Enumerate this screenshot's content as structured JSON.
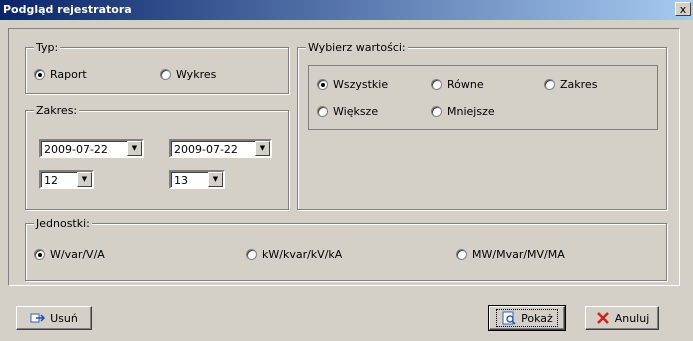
{
  "window": {
    "title": "Podgląd rejestratora",
    "close": "x"
  },
  "typ": {
    "legend": "Typ:",
    "options": [
      {
        "label": "Raport",
        "selected": true
      },
      {
        "label": "Wykres",
        "selected": false
      }
    ]
  },
  "zakres": {
    "legend": "Zakres:",
    "date_from": "2009-07-22",
    "date_to": "2009-07-22",
    "hour_from": "12",
    "hour_to": "13"
  },
  "wybierz": {
    "legend": "Wybierz wartości:",
    "options": [
      {
        "label": "Wszystkie",
        "selected": true
      },
      {
        "label": "Równe",
        "selected": false
      },
      {
        "label": "Zakres",
        "selected": false
      },
      {
        "label": "Większe",
        "selected": false
      },
      {
        "label": "Mniejsze",
        "selected": false
      }
    ]
  },
  "jednostki": {
    "legend": "Jednostki:",
    "options": [
      {
        "label": "W/var/V/A",
        "selected": true
      },
      {
        "label": "kW/kvar/kV/kA",
        "selected": false
      },
      {
        "label": "MW/Mvar/MV/MA",
        "selected": false
      }
    ]
  },
  "buttons": {
    "delete": "Usuń",
    "show": "Pokaż",
    "cancel": "Anuluj"
  },
  "icons": {
    "delete": "arrow-icon",
    "show": "chart-icon",
    "cancel": "x-icon",
    "dropdown": "chevron-down-icon"
  }
}
